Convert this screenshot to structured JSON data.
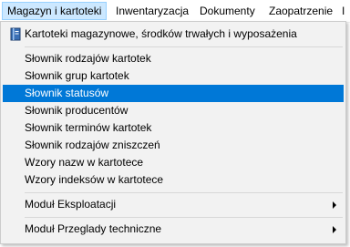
{
  "menubar": {
    "items": [
      {
        "label": "Magazyn i kartoteki"
      },
      {
        "label": "Inwentaryzacja"
      },
      {
        "label": "Dokumenty"
      },
      {
        "label": "Zaopatrzenie"
      },
      {
        "label": "I"
      }
    ]
  },
  "dropdown": {
    "header_item": {
      "label": "Kartoteki magazynowe, środków trwałych i wyposażenia",
      "icon": "book-icon"
    },
    "dictionary_items": [
      {
        "label": "Słownik rodzajów kartotek"
      },
      {
        "label": "Słownik grup kartotek"
      },
      {
        "label": "Słownik statusów"
      },
      {
        "label": "Słownik producentów"
      },
      {
        "label": "Słownik terminów kartotek"
      },
      {
        "label": "Słownik rodzajów zniszczeń"
      },
      {
        "label": "Wzory nazw w kartotece"
      },
      {
        "label": "Wzory indeksów w kartotece"
      }
    ],
    "submenus": [
      {
        "label": "Moduł Eksploatacji",
        "icon": "chevron-right-icon"
      },
      {
        "label": "Moduł Przeglady techniczne",
        "icon": "chevron-right-icon"
      }
    ]
  },
  "colors": {
    "highlight": "#0078d7",
    "menubar_active": "#cce8ff",
    "menu_background": "#f2f2f2"
  }
}
